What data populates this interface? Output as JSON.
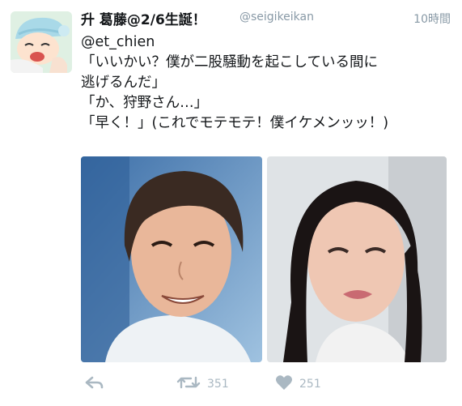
{
  "tweet": {
    "author_name": "升 葛藤@2/6生誕！",
    "author_handle": "@seigikeikan",
    "time": "10時間",
    "lines": [
      "@et_chien",
      "「いいかい？僕が二股騒動を起こしている間に",
      "逃げるんだ」",
      "「か、狩野さん…」",
      "「早く！」(これでモテモテ！僕イケメンッッ！)"
    ],
    "retweet_count": "351",
    "like_count": "251"
  },
  "icons": {
    "reply": "reply-icon",
    "retweet": "retweet-icon",
    "like": "heart-icon"
  },
  "colors": {
    "text": "#14171a",
    "muted": "#8899a6",
    "action": "#aab8c2"
  }
}
